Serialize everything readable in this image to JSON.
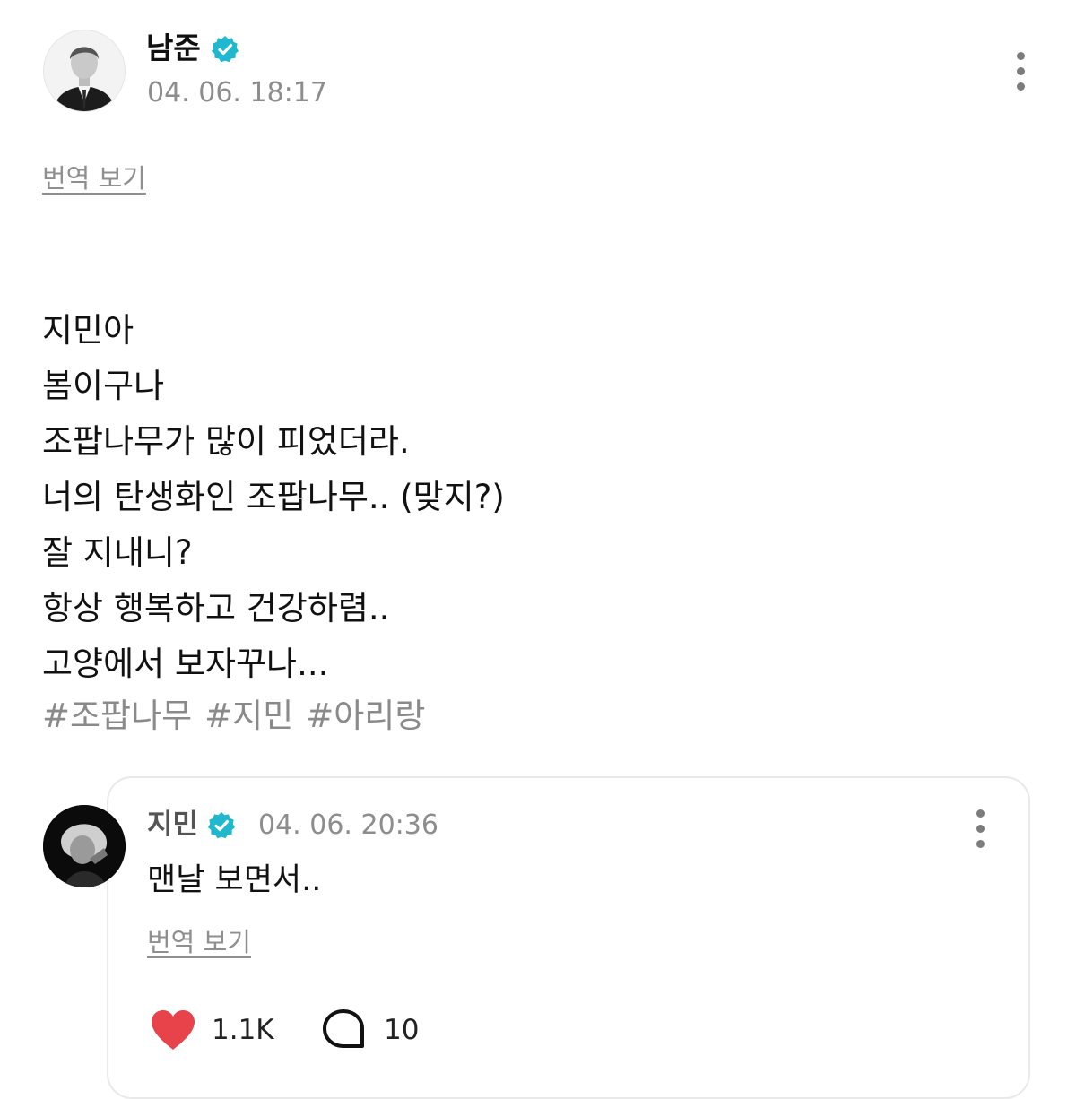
{
  "post": {
    "author": {
      "name": "남준",
      "verified_badge": "verified-check-icon",
      "avatar": "author-avatar-photo"
    },
    "timestamp": "04. 06. 18:17",
    "more_icon": "vertical-dots-icon",
    "translate_label": "번역 보기",
    "lines": [
      "지민아",
      "봄이구나",
      "조팝나무가 많이 피었더라.",
      "너의 탄생화인 조팝나무.. (맞지?)",
      "잘 지내니?",
      "항상 행복하고 건강하렴..",
      "고양에서 보자꾸나..."
    ],
    "hashtags": [
      "#조팝나무",
      "#지민",
      "#아리랑"
    ]
  },
  "reply": {
    "author": {
      "name": "지민",
      "verified_badge": "verified-check-icon",
      "avatar": "reply-avatar-photo"
    },
    "timestamp": "04. 06. 20:36",
    "more_icon": "vertical-dots-icon",
    "text": "맨날 보면서..",
    "translate_label": "번역 보기",
    "likes": "1.1K",
    "comments": "10",
    "like_icon": "heart-icon",
    "comment_icon": "speech-bubble-icon"
  },
  "colors": {
    "badge": "#1fb8cf",
    "heart": "#e8424a",
    "muted_text": "#8d8d8d",
    "card_border": "#e9e9e9"
  }
}
